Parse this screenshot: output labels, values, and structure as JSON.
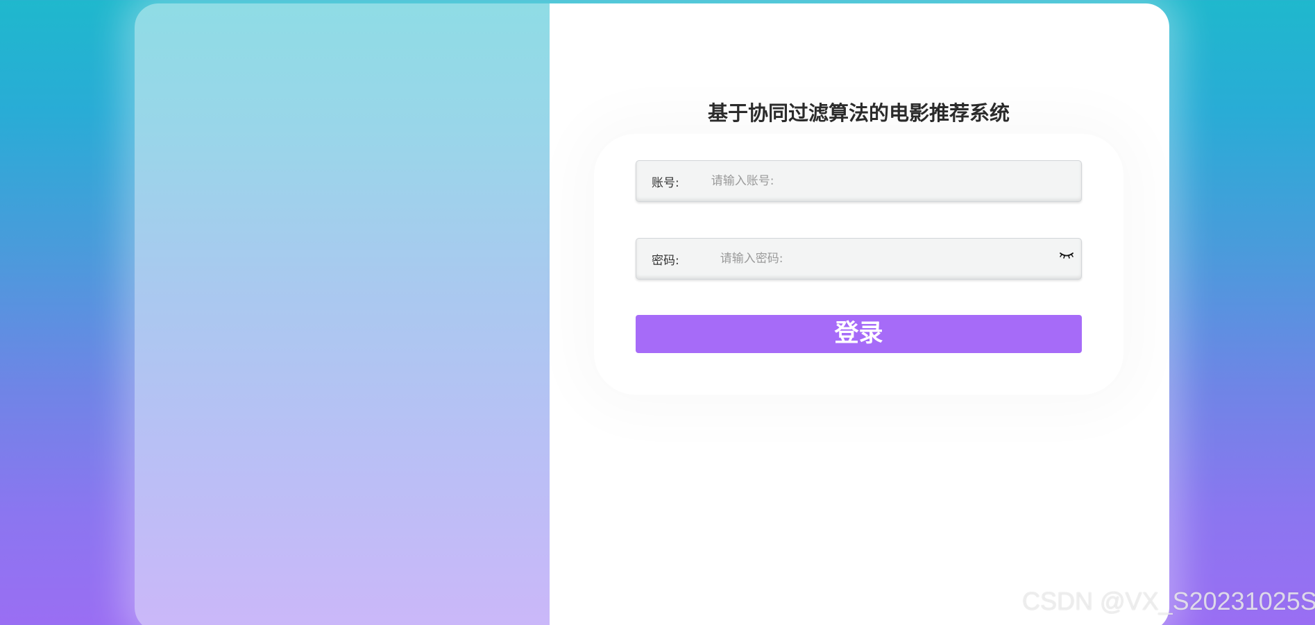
{
  "page": {
    "title": "基于协同过滤算法的电影推荐系统"
  },
  "form": {
    "account": {
      "label": "账号:",
      "placeholder": "请输入账号:",
      "value": ""
    },
    "password": {
      "label": "密码:",
      "placeholder": "请输入密码:",
      "value": "",
      "toggle_icon": "eye-closed-icon"
    },
    "login_label": "登录"
  },
  "watermark": "CSDN @VX_S20231025S",
  "colors": {
    "background_top": "#1fb8cd",
    "background_bottom": "#9a6ef3",
    "login_button": "#a66bf8",
    "title_text": "#2b2b2b"
  }
}
